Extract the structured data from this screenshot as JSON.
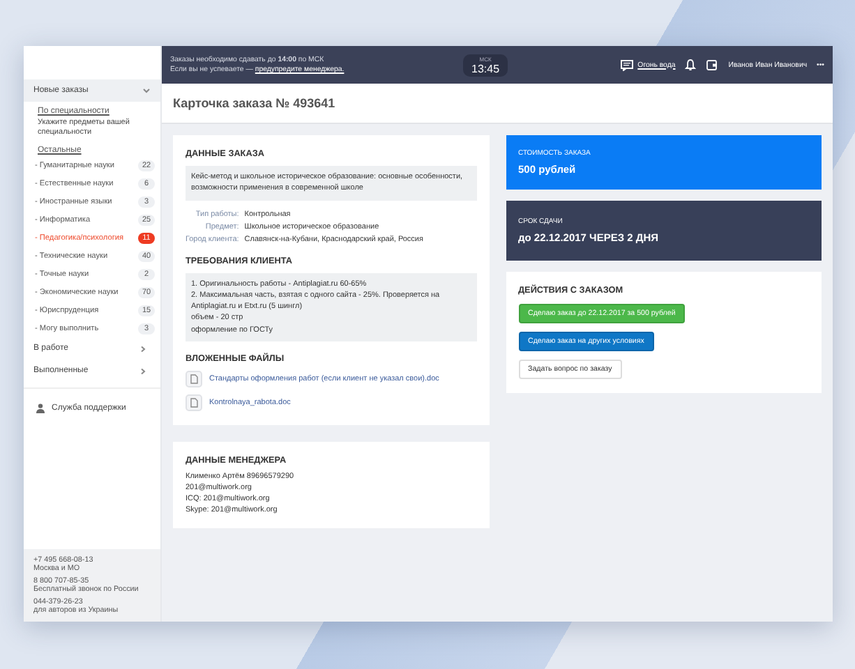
{
  "sidebar": {
    "section": {
      "label": "Новые заказы",
      "expanded": true
    },
    "specialty_link": "По специальности",
    "specialty_hint": "Укажите предметы вашей специальности",
    "other_link": "Остальные",
    "categories": [
      {
        "label": "- Гуманитарные науки",
        "count": "22",
        "selected": false
      },
      {
        "label": "- Естественные науки",
        "count": "6",
        "selected": false
      },
      {
        "label": "- Иностранные языки",
        "count": "3",
        "selected": false
      },
      {
        "label": "- Информатика",
        "count": "25",
        "selected": false
      },
      {
        "label": "- Педагогика/психология",
        "count": "11",
        "selected": true
      },
      {
        "label": "- Технические науки",
        "count": "40",
        "selected": false
      },
      {
        "label": "- Точные науки",
        "count": "2",
        "selected": false
      },
      {
        "label": "- Экономические науки",
        "count": "70",
        "selected": false
      },
      {
        "label": "- Юриспруденция",
        "count": "15",
        "selected": false
      },
      {
        "label": "- Могу выполнить",
        "count": "3",
        "selected": false
      }
    ],
    "groups": [
      "В работе",
      "Выполненные"
    ],
    "support": "Служба поддержки",
    "contacts": [
      {
        "phone": "+7 495 668-08-13",
        "note": "Москва и МО"
      },
      {
        "phone": "8 800 707-85-35",
        "note": "Бесплатный звонок по России"
      },
      {
        "phone": "044-379-26-23",
        "note": "для авторов из Украины"
      }
    ]
  },
  "topbar": {
    "notice": "Заказы необходимо сдавать до **14:00** по МСК",
    "notice_line2": "Если вы не успеваете —",
    "notice_link": "предупредите менеджера.",
    "clock_zone": "МСК",
    "clock_time": "13:45",
    "feedback": "Огонь вода",
    "user": "Иванов Иван Иванович",
    "more": "•••"
  },
  "page_title": "Карточка заказа № 493641",
  "order": {
    "heading": "ДАННЫЕ ЗАКАЗА",
    "topic": "Кейс-метод и школьное историческое образование: основные особенности, возможности применения в современной школе",
    "fields": [
      {
        "label": "Тип работы:",
        "value": "Контрольная"
      },
      {
        "label": "Предмет:",
        "value": "Школьное историческое образование"
      },
      {
        "label": "Город клиента:",
        "value": "Славянск-на-Кубани, Краснодарский край, Россия"
      }
    ],
    "requirements_heading": "ТРЕБОВАНИЯ КЛИЕНТА",
    "requirements": [
      "1. Оригинальность работы - Antiplagiat.ru 60-65%",
      "2. Максимальная часть, взятая с одного сайта - 25%. Проверяется на Antiplagiat.ru и Etxt.ru (5 шингл)",
      "объем - 20 стр",
      "оформление по ГОСТу"
    ],
    "files_heading": "ВЛОЖЕННЫЕ ФАЙЛЫ",
    "files": [
      "Стандарты оформления работ (если клиент не указал свои).doc",
      "Kontrolnaya_rabota.doc"
    ]
  },
  "manager": {
    "heading": "ДАННЫЕ МЕНЕДЖЕРА",
    "lines": [
      "Клименко Артём 89696579290",
      "201@multiwork.org",
      "ICQ: 201@multiwork.org",
      "Skype: 201@multiwork.org"
    ]
  },
  "price": {
    "label": "СТОИМОСТЬ ЗАКАЗА",
    "value": "500 рублей"
  },
  "deadline": {
    "label": "СРОК СДАЧИ",
    "value": "до 22.12.2017 ЧЕРЕЗ 2 ДНЯ"
  },
  "actions": {
    "heading": "ДЕЙСТВИЯ С ЗАКАЗОМ",
    "buttons": [
      {
        "label": "Сделаю заказ до 22.12.2017 за 500 рублей",
        "kind": "accept"
      },
      {
        "label": "Сделаю заказ на других условиях",
        "kind": "offer"
      },
      {
        "label": "Задать вопрос по заказу",
        "kind": "plain"
      }
    ]
  }
}
